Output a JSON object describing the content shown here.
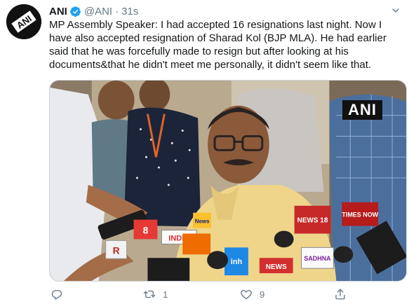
{
  "tweet": {
    "author_name": "ANI",
    "handle": "@ANI",
    "separator": "·",
    "time": "31s",
    "text": "MP Assembly Speaker: I had accepted 16 resignations last night. Now I have also accepted resignation of Sharad Kol (BJP MLA). He had earlier said that he was forcefully made to resign but after looking at his documents&that he didn't meet me personally, it didn't seem like that.",
    "avatar_text": "ANI",
    "verified": true
  },
  "media": {
    "watermark": "ANI",
    "mic_labels": [
      "INDIA",
      "NEWS 18",
      "TIMES NOW",
      "R",
      "8",
      "News",
      "SADHNA",
      "inh",
      "NEWS"
    ]
  },
  "actions": {
    "reply_count": "",
    "retweet_count": "1",
    "like_count": "9"
  },
  "colors": {
    "accent": "#1da1f2",
    "text": "#14171a",
    "muted": "#657786"
  },
  "icons": {
    "avatar": "ani-logo",
    "verified": "verified-badge-icon",
    "menu": "chevron-down-icon",
    "reply": "reply-icon",
    "retweet": "retweet-icon",
    "like": "heart-icon",
    "share": "share-icon"
  }
}
